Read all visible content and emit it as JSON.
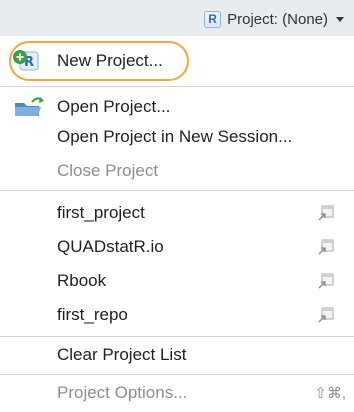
{
  "toolbar": {
    "project_button_label": "Project: (None)",
    "project_icon": "r-project-icon",
    "r_glyph": "R"
  },
  "menu": {
    "new_project": "New Project...",
    "open_project": "Open Project...",
    "open_new_session": "Open Project in New Session...",
    "close_project": "Close Project",
    "recent": [
      {
        "name": "first_project"
      },
      {
        "name": "QUADstatR.io"
      },
      {
        "name": "Rbook"
      },
      {
        "name": "first_repo"
      }
    ],
    "clear_list": "Clear Project List",
    "project_options": "Project Options...",
    "project_options_shortcut": "⇧⌘,"
  },
  "colors": {
    "highlight_ring": "#f4a73a",
    "new_icon_green": "#3aa14a",
    "open_folder_blue": "#4c86c7",
    "disabled_text": "#8e8e8e"
  }
}
